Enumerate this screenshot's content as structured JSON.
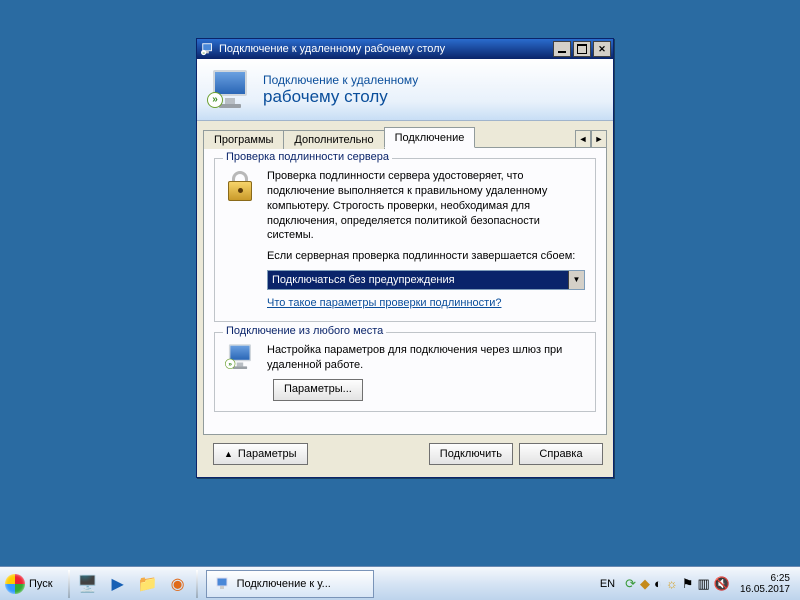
{
  "window": {
    "title": "Подключение к удаленному рабочему столу",
    "banner_line1": "Подключение к удаленному",
    "banner_line2": "рабочему столу"
  },
  "tabs": {
    "items": [
      "Программы",
      "Дополнительно",
      "Подключение"
    ],
    "active_index": 2
  },
  "group_auth": {
    "caption": "Проверка подлинности сервера",
    "para1": "Проверка подлинности сервера удостоверяет, что подключение выполняется к правильному удаленному компьютеру. Строгость проверки, необходимая для подключения, определяется политикой безопасности системы.",
    "para2": "Если серверная проверка подлинности завершается сбоем:",
    "dropdown_value": "Подключаться без предупреждения",
    "link": "Что такое параметры проверки подлинности?"
  },
  "group_anywhere": {
    "caption": "Подключение из любого места",
    "para": "Настройка параметров для подключения через шлюз при удаленной работе.",
    "button": "Параметры..."
  },
  "footer": {
    "options_btn": "Параметры",
    "connect_btn": "Подключить",
    "help_btn": "Справка"
  },
  "taskbar": {
    "start": "Пуск",
    "task_title": "Подключение к у...",
    "lang": "EN",
    "time": "6:25",
    "date": "16.05.2017"
  }
}
